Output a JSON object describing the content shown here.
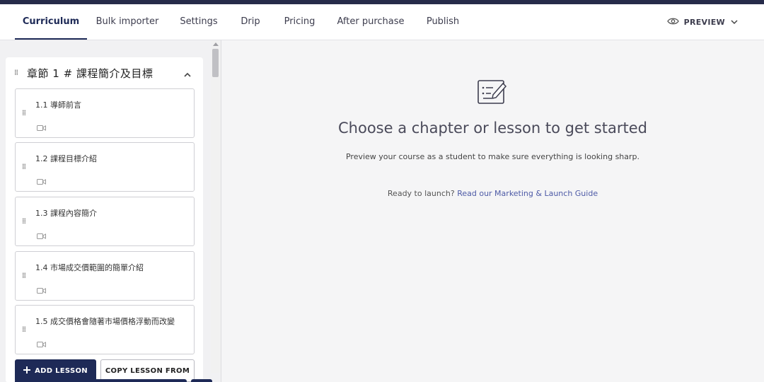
{
  "tabs": [
    {
      "label": "Curriculum",
      "active": true
    },
    {
      "label": "Bulk importer",
      "active": false
    },
    {
      "label": "Settings",
      "active": false
    },
    {
      "label": "Drip",
      "active": false
    },
    {
      "label": "Pricing",
      "active": false
    },
    {
      "label": "After purchase",
      "active": false
    },
    {
      "label": "Publish",
      "active": false
    }
  ],
  "preview": {
    "label": "PREVIEW",
    "icon": "eye-icon"
  },
  "sidebar": {
    "chapter": {
      "title": "章節 1 # 課程簡介及目標",
      "lessons": [
        {
          "title": "1.1 導師前言",
          "icon": "video-icon"
        },
        {
          "title": "1.2 課程目標介紹",
          "icon": "video-icon"
        },
        {
          "title": "1.3 課程內容簡介",
          "icon": "video-icon"
        },
        {
          "title": "1.4 市場成交價範圍的簡單介紹",
          "icon": "video-icon"
        },
        {
          "title": "1.5 成交價格會隨著市場價格浮動而改變",
          "icon": "video-icon"
        }
      ]
    },
    "add_lesson_label": "ADD LESSON",
    "copy_lesson_label": "COPY LESSON FROM"
  },
  "main": {
    "heading": "Choose a chapter or lesson to get started",
    "subtext": "Preview your course as a student to make sure everything is looking sharp.",
    "launch_prefix": "Ready to launch?",
    "launch_link": "Read our Marketing & Launch Guide"
  },
  "colors": {
    "brand": "#1e2a57",
    "link": "#4d5aa6",
    "topbar": "#262b4a"
  }
}
